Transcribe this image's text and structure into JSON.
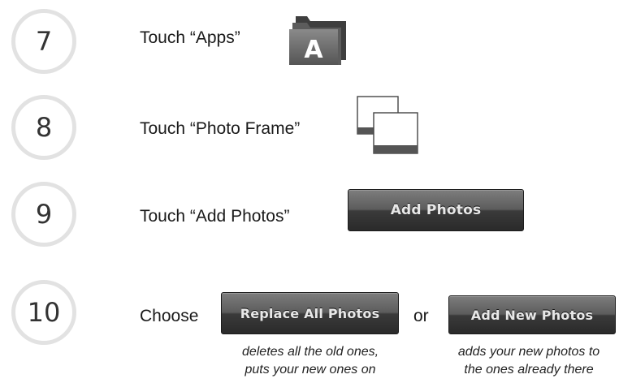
{
  "steps": [
    {
      "number": "7",
      "instruction": "Touch “Apps”",
      "icon": "apps-folder-icon"
    },
    {
      "number": "8",
      "instruction": "Touch “Photo Frame”",
      "icon": "photo-frame-icon"
    },
    {
      "number": "9",
      "instruction": "Touch “Add Photos”",
      "button_label": "Add Photos"
    },
    {
      "number": "10",
      "instruction": "Choose"
    }
  ],
  "apps_icon_letter": "A",
  "choices": {
    "replace_label": "Replace All Photos",
    "or_text": "or",
    "add_new_label": "Add New Photos",
    "replace_note_line1": "deletes all the old ones,",
    "replace_note_line2": "puts your new ones on",
    "add_new_note_line1": "adds your new photos to",
    "add_new_note_line2": "the ones already there"
  }
}
